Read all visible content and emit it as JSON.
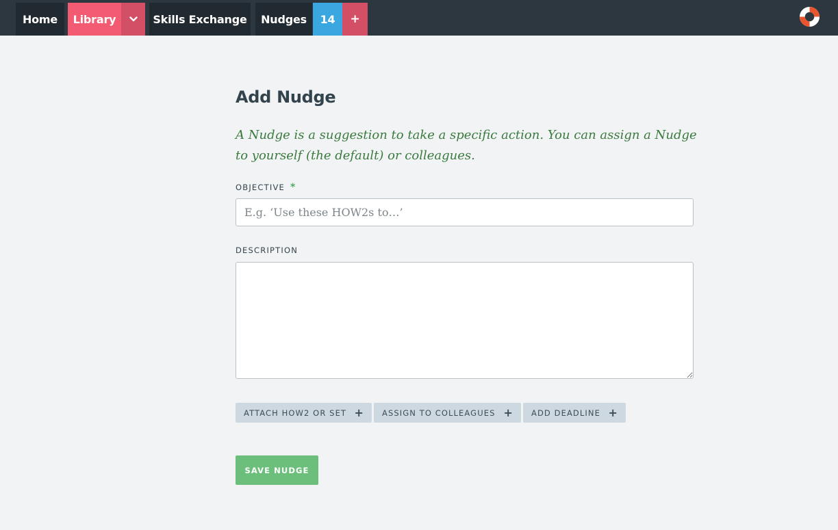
{
  "nav": {
    "home": "Home",
    "library": "Library",
    "library_toggle_glyph": "⌄",
    "skills_exchange": "Skills Exchange",
    "nudges": "Nudges",
    "nudges_count": "14",
    "add_glyph": "+"
  },
  "icons": {
    "help": "lifebuoy-icon",
    "library_toggle": "chevron-down-icon",
    "add": "plus-icon"
  },
  "colors": {
    "topbar": "#2d3740",
    "library_accent": "#f25b72",
    "count_badge": "#3aa7e0",
    "intro_text": "#3b7a3e",
    "save_button": "#6bbf7b",
    "help_icon": "#e8552f"
  },
  "form": {
    "title": "Add Nudge",
    "intro": "A Nudge is a suggestion to take a specific action. You can assign a Nudge to yourself (the default) or colleagues.",
    "objective": {
      "label": "OBJECTIVE",
      "required_mark": "*",
      "placeholder": "E.g. ‘Use these HOW2s to…’",
      "value": ""
    },
    "description": {
      "label": "DESCRIPTION",
      "value": ""
    },
    "actions": {
      "attach": "ATTACH HOW2 OR SET",
      "assign": "ASSIGN TO COLLEAGUES",
      "deadline": "ADD DEADLINE",
      "plus": "+"
    },
    "save_label": "SAVE NUDGE"
  }
}
